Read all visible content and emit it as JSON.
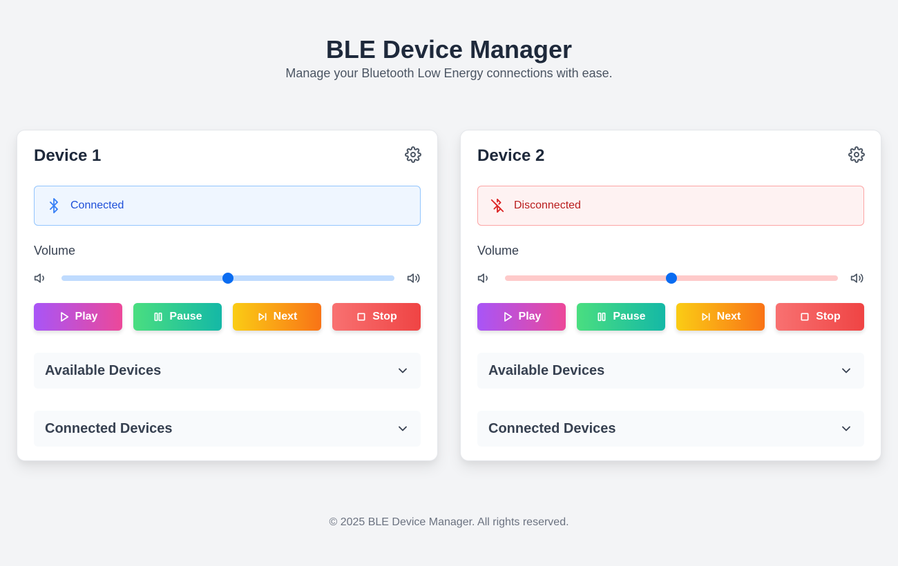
{
  "header": {
    "title": "BLE Device Manager",
    "subtitle": "Manage your Bluetooth Low Energy connections with ease."
  },
  "devices": [
    {
      "title": "Device 1",
      "status": "Connected",
      "status_icon": "bluetooth-icon",
      "volume_label": "Volume",
      "volume_percent": 50,
      "buttons": {
        "play": "Play",
        "pause": "Pause",
        "next": "Next",
        "stop": "Stop"
      },
      "available_label": "Available Devices",
      "connected_label": "Connected Devices"
    },
    {
      "title": "Device 2",
      "status": "Disconnected",
      "status_icon": "bluetooth-off-icon",
      "volume_label": "Volume",
      "volume_percent": 50,
      "buttons": {
        "play": "Play",
        "pause": "Pause",
        "next": "Next",
        "stop": "Stop"
      },
      "available_label": "Available Devices",
      "connected_label": "Connected Devices"
    }
  ],
  "footer": {
    "text": "© 2025 BLE Device Manager. All rights reserved."
  },
  "colors": {
    "connected": "#1d4ed8",
    "disconnected": "#b91c1c",
    "slider_thumb": "#0a6cf1"
  }
}
